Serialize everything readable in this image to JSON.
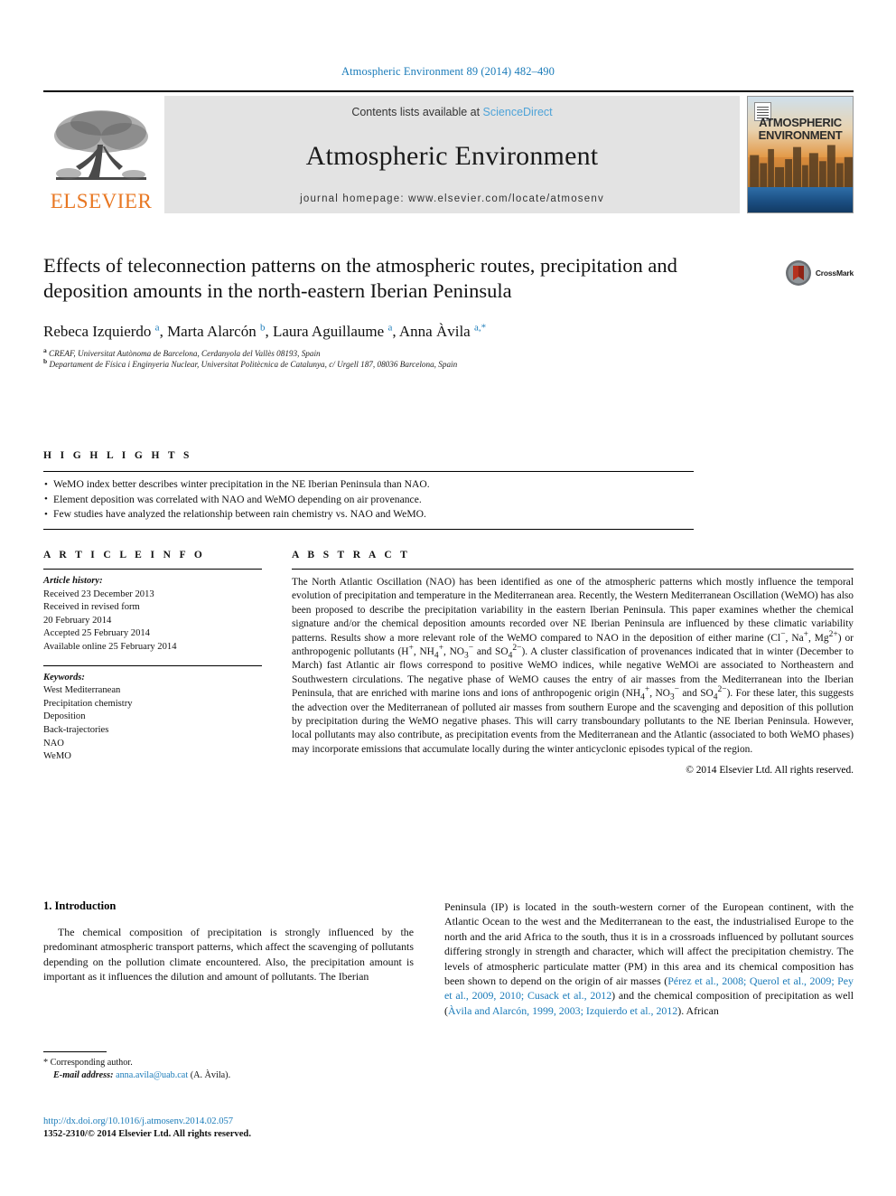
{
  "running_head": "Atmospheric Environment 89 (2014) 482–490",
  "masthead": {
    "publisher_name": "ELSEVIER",
    "contents_prefix": "Contents lists available at ",
    "sciencedirect": "ScienceDirect",
    "journal_title": "Atmospheric Environment",
    "homepage": "journal homepage: www.elsevier.com/locate/atmosenv",
    "cover_line1": "ATMOSPHERIC",
    "cover_line2": "ENVIRONMENT"
  },
  "crossmark": {
    "label": "CrossMark"
  },
  "article": {
    "title": "Effects of teleconnection patterns on the atmospheric routes, precipitation and deposition amounts in the north-eastern Iberian Peninsula",
    "authors_html": "Rebeca Izquierdo <sup>a</sup>, Marta Alarcón <sup>b</sup>, Laura Aguillaume <sup>a</sup>, Anna Àvila <sup>a,*</sup>",
    "affiliation_a": "CREAF, Universitat Autònoma de Barcelona, Cerdanyola del Vallès 08193, Spain",
    "affiliation_b": "Departament de Física i Enginyeria Nuclear, Universitat Politècnica de Catalunya, c/ Urgell 187, 08036 Barcelona, Spain"
  },
  "highlights": {
    "heading": "H I G H L I G H T S",
    "items": [
      "WeMO index better describes winter precipitation in the NE Iberian Peninsula than NAO.",
      "Element deposition was correlated with NAO and WeMO depending on air provenance.",
      "Few studies have analyzed the relationship between rain chemistry vs. NAO and WeMO."
    ]
  },
  "article_info": {
    "heading": "A R T I C L E   I N F O",
    "history_label": "Article history:",
    "history": [
      "Received 23 December 2013",
      "Received in revised form",
      "20 February 2014",
      "Accepted 25 February 2014",
      "Available online 25 February 2014"
    ],
    "keywords_label": "Keywords:",
    "keywords": [
      "West Mediterranean",
      "Precipitation chemistry",
      "Deposition",
      "Back-trajectories",
      "NAO",
      "WeMO"
    ]
  },
  "abstract": {
    "heading": "A B S T R A C T",
    "text_html": "The North Atlantic Oscillation (NAO) has been identified as one of the atmospheric patterns which mostly influence the temporal evolution of precipitation and temperature in the Mediterranean area. Recently, the Western Mediterranean Oscillation (WeMO) has also been proposed to describe the precipitation variability in the eastern Iberian Peninsula. This paper examines whether the chemical signature and/or the chemical deposition amounts recorded over NE Iberian Peninsula are influenced by these climatic variability patterns. Results show a more relevant role of the WeMO compared to NAO in the deposition of either marine (Cl<sup>&#8722;</sup>, Na<sup>+</sup>, Mg<sup>2+</sup>) or anthropogenic pollutants (H<sup>+</sup>, NH<sub>4</sub><sup>+</sup>, NO<sub>3</sub><sup>&#8722;</sup> and SO<sub>4</sub><sup>2&#8722;</sup>). A cluster classification of provenances indicated that in winter (December to March) fast Atlantic air flows correspond to positive WeMO indices, while negative WeMOi are associated to Northeastern and Southwestern circulations. The negative phase of WeMO causes the entry of air masses from the Mediterranean into the Iberian Peninsula, that are enriched with marine ions and ions of anthropogenic origin (NH<sub>4</sub><sup>+</sup>, NO<sub>3</sub><sup>&#8722;</sup> and SO<sub>4</sub><sup>2&#8722;</sup>). For these later, this suggests the advection over the Mediterranean of polluted air masses from southern Europe and the scavenging and deposition of this pollution by precipitation during the WeMO negative phases. This will carry transboundary pollutants to the NE Iberian Peninsula. However, local pollutants may also contribute, as precipitation events from the Mediterranean and the Atlantic (associated to both WeMO phases) may incorporate emissions that accumulate locally during the winter anticyclonic episodes typical of the region.",
    "copyright": "© 2014 Elsevier Ltd. All rights reserved."
  },
  "introduction": {
    "heading": "1. Introduction",
    "left_paragraph": "The chemical composition of precipitation is strongly influenced by the predominant atmospheric transport patterns, which affect the scavenging of pollutants depending on the pollution climate encountered. Also, the precipitation amount is important as it influences the dilution and amount of pollutants. The Iberian",
    "right_paragraph_html": "Peninsula (IP) is located in the south-western corner of the European continent, with the Atlantic Ocean to the west and the Mediterranean to the east, the industrialised Europe to the north and the arid Africa to the south, thus it is in a crossroads influenced by pollutant sources differing strongly in strength and character, which will affect the precipitation chemistry. The levels of atmospheric particulate matter (PM) in this area and its chemical composition has been shown to depend on the origin of air masses (<span class=\"cite\">Pérez et al., 2008; Querol et al., 2009; Pey et al., 2009, 2010; Cusack et al., 2012</span>) and the chemical composition of precipitation as well (<span class=\"cite\">Àvila and Alarcón, 1999, 2003; Izquierdo et al., 2012</span>). African"
  },
  "footnote": {
    "corresponding": "* Corresponding author.",
    "email_label": "E-mail address:",
    "email": "anna.avila@uab.cat",
    "email_suffix": "(A. Àvila)."
  },
  "footer": {
    "doi": "http://dx.doi.org/10.1016/j.atmosenv.2014.02.057",
    "issn": "1352-2310/© 2014 Elsevier Ltd. All rights reserved."
  },
  "colors": {
    "link_blue": "#1a7bb9",
    "sciencedirect_blue": "#4ea3d8",
    "elsevier_orange": "#E87722"
  }
}
